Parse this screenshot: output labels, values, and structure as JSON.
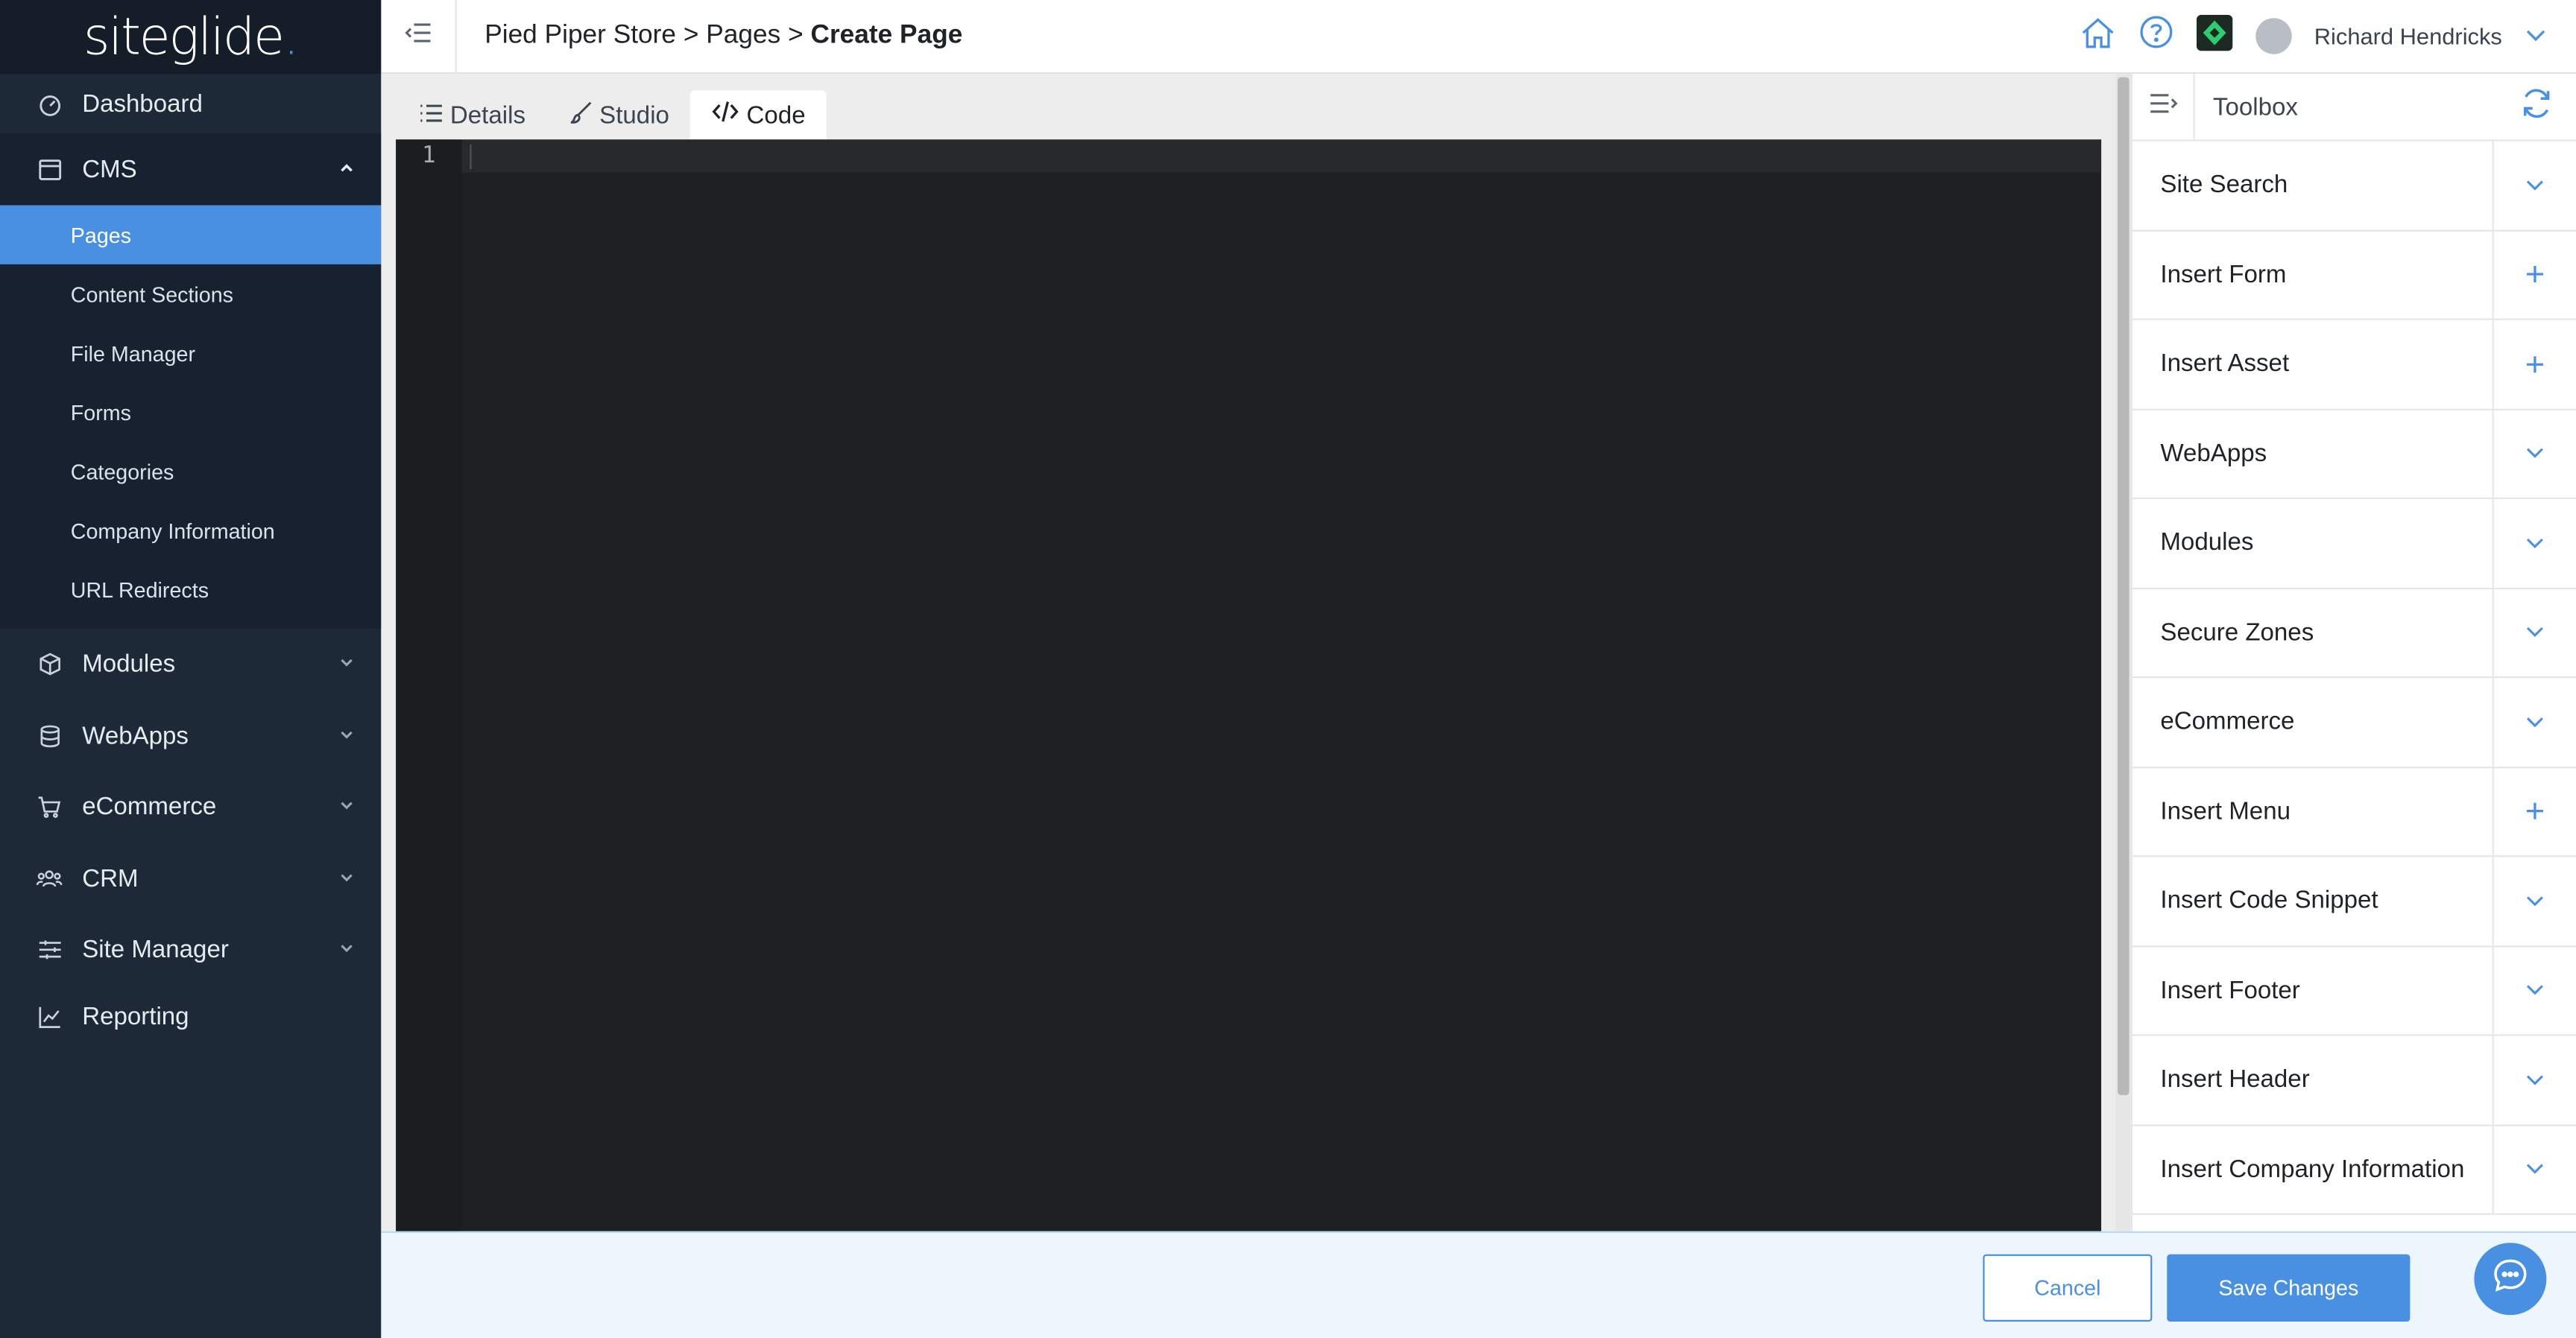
{
  "app": {
    "logo_text": "siteglide",
    "logo_dot": "."
  },
  "colors": {
    "accent": "#4a90e2",
    "sidebar_bg": "#1e2937",
    "editor_bg": "#1f2023"
  },
  "sidebar": {
    "dashboard": "Dashboard",
    "cms": "CMS",
    "cms_items": [
      {
        "label": "Pages",
        "active": true
      },
      {
        "label": "Content Sections"
      },
      {
        "label": "File Manager"
      },
      {
        "label": "Forms"
      },
      {
        "label": "Categories"
      },
      {
        "label": "Company Information"
      },
      {
        "label": "URL Redirects"
      }
    ],
    "items": [
      {
        "label": "Modules",
        "icon": "cube-icon"
      },
      {
        "label": "WebApps",
        "icon": "database-icon"
      },
      {
        "label": "eCommerce",
        "icon": "cart-icon"
      },
      {
        "label": "CRM",
        "icon": "users-icon"
      },
      {
        "label": "Site Manager",
        "icon": "sliders-icon"
      }
    ],
    "reporting": "Reporting"
  },
  "header": {
    "breadcrumb_1": "Pied Piper Store",
    "separator": ">",
    "breadcrumb_2": "Pages",
    "breadcrumb_current": "Create Page",
    "user_name": "Richard Hendricks"
  },
  "tabs": [
    {
      "label": "Details",
      "icon": "list-icon"
    },
    {
      "label": "Studio",
      "icon": "brush-icon"
    },
    {
      "label": "Code",
      "icon": "code-icon",
      "active": true
    }
  ],
  "editor": {
    "line_number": "1"
  },
  "toolbox": {
    "title": "Toolbox",
    "rows": [
      {
        "label": "Site Search",
        "action": "expand"
      },
      {
        "label": "Insert Form",
        "action": "add"
      },
      {
        "label": "Insert Asset",
        "action": "add"
      },
      {
        "label": "WebApps",
        "action": "expand"
      },
      {
        "label": "Modules",
        "action": "expand"
      },
      {
        "label": "Secure Zones",
        "action": "expand"
      },
      {
        "label": "eCommerce",
        "action": "expand"
      },
      {
        "label": "Insert Menu",
        "action": "add"
      },
      {
        "label": "Insert Code Snippet",
        "action": "expand"
      },
      {
        "label": "Insert Footer",
        "action": "expand"
      },
      {
        "label": "Insert Header",
        "action": "expand"
      },
      {
        "label": "Insert Company Information",
        "action": "expand"
      }
    ]
  },
  "footer": {
    "cancel_label": "Cancel",
    "save_label": "Save Changes"
  }
}
